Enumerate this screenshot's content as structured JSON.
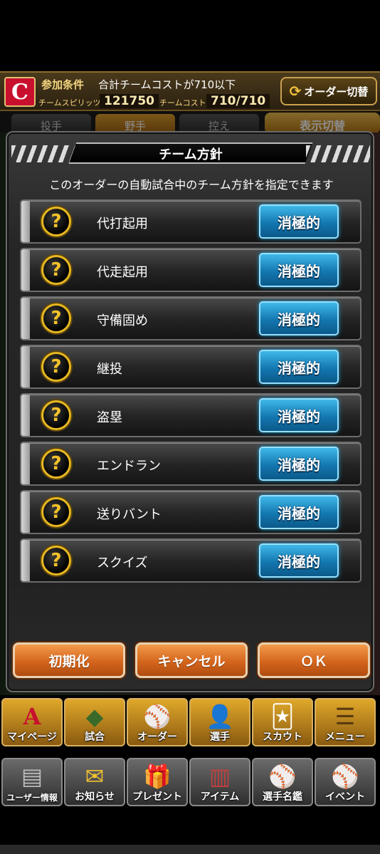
{
  "header": {
    "logo_letter": "C",
    "condition_label": "参加条件",
    "condition_text": "合計チームコストが710以下",
    "spirits_label": "チームスピリッツ",
    "spirits_value": "121750",
    "cost_label": "チームコスト",
    "cost_value": "710/710",
    "order_switch_label": "オーダー切替"
  },
  "tabs": [
    {
      "label": "投手"
    },
    {
      "label": "野手"
    },
    {
      "label": "控え"
    }
  ],
  "display_switch_label": "表示切替",
  "modal": {
    "title": "チーム方針",
    "subtitle": "このオーダーの自動試合中のチーム方針を指定できます",
    "rows": [
      {
        "label": "代打起用",
        "value": "消極的"
      },
      {
        "label": "代走起用",
        "value": "消極的"
      },
      {
        "label": "守備固め",
        "value": "消極的"
      },
      {
        "label": "継投",
        "value": "消極的"
      },
      {
        "label": "盗塁",
        "value": "消極的"
      },
      {
        "label": "エンドラン",
        "value": "消極的"
      },
      {
        "label": "送りバント",
        "value": "消極的"
      },
      {
        "label": "スクイズ",
        "value": "消極的"
      }
    ],
    "help_glyph": "?",
    "buttons": {
      "reset": "初期化",
      "cancel": "キャンセル",
      "ok": "ＯＫ"
    }
  },
  "nav_primary": [
    {
      "label": "マイページ",
      "icon": "mypage-icon",
      "glyph": "A"
    },
    {
      "label": "試合",
      "icon": "stadium-icon",
      "glyph": "◆"
    },
    {
      "label": "オーダー",
      "icon": "order-icon",
      "glyph": "⚾"
    },
    {
      "label": "選手",
      "icon": "player-icon",
      "glyph": "👤"
    },
    {
      "label": "スカウト",
      "icon": "scout-icon",
      "glyph": "🃏"
    },
    {
      "label": "メニュー",
      "icon": "menu-icon",
      "glyph": "☰"
    }
  ],
  "nav_secondary": [
    {
      "label": "ユーザー情報",
      "icon": "user-info-icon",
      "glyph": "▤"
    },
    {
      "label": "お知らせ",
      "icon": "notice-icon",
      "glyph": "✉"
    },
    {
      "label": "プレゼント",
      "icon": "present-icon",
      "glyph": "🎁"
    },
    {
      "label": "アイテム",
      "icon": "item-icon",
      "glyph": "▥"
    },
    {
      "label": "選手名鑑",
      "icon": "player-book-icon",
      "glyph": "⚾"
    },
    {
      "label": "イベント",
      "icon": "event-icon",
      "glyph": "⚾"
    }
  ],
  "colors": {
    "policy_blue": "#1a8fc8",
    "footer_orange": "#d4651c",
    "nav_gold": "#e0a82a",
    "help_yellow": "#f3c22a"
  }
}
